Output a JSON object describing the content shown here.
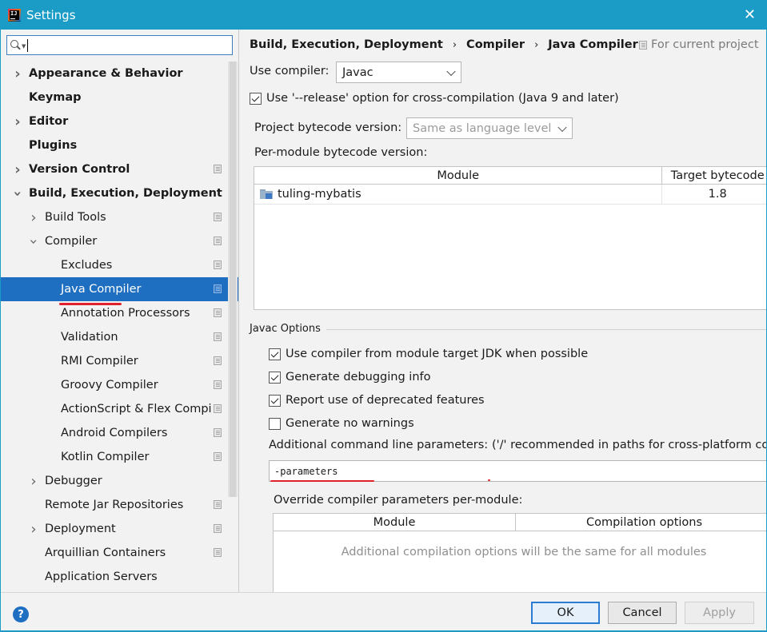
{
  "window": {
    "title": "Settings",
    "app_icon_letters": "IJ",
    "close_glyph": "✕"
  },
  "sidebar": {
    "search": {
      "value": "",
      "placeholder": ""
    },
    "items": [
      {
        "label": "Appearance & Behavior",
        "bold": true,
        "arrow": "right",
        "indent": 0,
        "proj": false
      },
      {
        "label": "Keymap",
        "bold": true,
        "arrow": "none",
        "indent": 0,
        "proj": false
      },
      {
        "label": "Editor",
        "bold": true,
        "arrow": "right",
        "indent": 0,
        "proj": false
      },
      {
        "label": "Plugins",
        "bold": true,
        "arrow": "none",
        "indent": 0,
        "proj": false
      },
      {
        "label": "Version Control",
        "bold": true,
        "arrow": "right",
        "indent": 0,
        "proj": true
      },
      {
        "label": "Build, Execution, Deployment",
        "bold": true,
        "arrow": "down",
        "indent": 0,
        "proj": false
      },
      {
        "label": "Build Tools",
        "bold": false,
        "arrow": "right",
        "indent": 1,
        "proj": true
      },
      {
        "label": "Compiler",
        "bold": false,
        "arrow": "down",
        "indent": 1,
        "proj": true
      },
      {
        "label": "Excludes",
        "bold": false,
        "arrow": "none",
        "indent": 2,
        "proj": true
      },
      {
        "label": "Java Compiler",
        "bold": false,
        "arrow": "none",
        "indent": 2,
        "proj": true,
        "selected": true
      },
      {
        "label": "Annotation Processors",
        "bold": false,
        "arrow": "none",
        "indent": 2,
        "proj": true
      },
      {
        "label": "Validation",
        "bold": false,
        "arrow": "none",
        "indent": 2,
        "proj": true
      },
      {
        "label": "RMI Compiler",
        "bold": false,
        "arrow": "none",
        "indent": 2,
        "proj": true
      },
      {
        "label": "Groovy Compiler",
        "bold": false,
        "arrow": "none",
        "indent": 2,
        "proj": true
      },
      {
        "label": "ActionScript & Flex Compi",
        "bold": false,
        "arrow": "none",
        "indent": 2,
        "proj": true
      },
      {
        "label": "Android Compilers",
        "bold": false,
        "arrow": "none",
        "indent": 2,
        "proj": true
      },
      {
        "label": "Kotlin Compiler",
        "bold": false,
        "arrow": "none",
        "indent": 2,
        "proj": true
      },
      {
        "label": "Debugger",
        "bold": false,
        "arrow": "right",
        "indent": 1,
        "proj": false
      },
      {
        "label": "Remote Jar Repositories",
        "bold": false,
        "arrow": "none",
        "indent": 1,
        "proj": true
      },
      {
        "label": "Deployment",
        "bold": false,
        "arrow": "right",
        "indent": 1,
        "proj": true
      },
      {
        "label": "Arquillian Containers",
        "bold": false,
        "arrow": "none",
        "indent": 1,
        "proj": true
      },
      {
        "label": "Application Servers",
        "bold": false,
        "arrow": "none",
        "indent": 1,
        "proj": false
      }
    ]
  },
  "main": {
    "breadcrumb": [
      "Build, Execution, Deployment",
      "Compiler",
      "Java Compiler"
    ],
    "breadcrumb_sep": "›",
    "for_current_project": "For current project",
    "use_compiler_label": "Use compiler:",
    "use_compiler_value": "Javac",
    "release_option_label": "Use '--release' option for cross-compilation (Java 9 and later)",
    "release_option_checked": true,
    "bytecode_version_label": "Project bytecode version:",
    "bytecode_version_value": "Same as language level",
    "per_module_label": "Per-module bytecode version:",
    "module_table": {
      "headers": [
        "Module",
        "Target bytecode"
      ],
      "rows": [
        {
          "module": "tuling-mybatis",
          "target": "1.8"
        }
      ]
    },
    "javac_options_title": "Javac Options",
    "javac_checkboxes": [
      {
        "label": "Use compiler from module target JDK when possible",
        "checked": true
      },
      {
        "label": "Generate debugging info",
        "checked": true
      },
      {
        "label": "Report use of deprecated features",
        "checked": true
      },
      {
        "label": "Generate no warnings",
        "checked": false
      }
    ],
    "additional_params_label": "Additional command line parameters:",
    "additional_params_hint": "('/' recommended in paths for cross-platform cor",
    "additional_params_value": "-parameters",
    "override_label": "Override compiler parameters per-module:",
    "override_table": {
      "headers": [
        "Module",
        "Compilation options"
      ],
      "empty_text": "Additional compilation options will be the same for all modules"
    }
  },
  "buttons": {
    "help": "?",
    "ok": "OK",
    "cancel": "Cancel",
    "apply": "Apply"
  },
  "colors": {
    "titlebar": "#1b9cc6",
    "selection": "#1e6fc2",
    "annotation_red": "#e0202a"
  }
}
